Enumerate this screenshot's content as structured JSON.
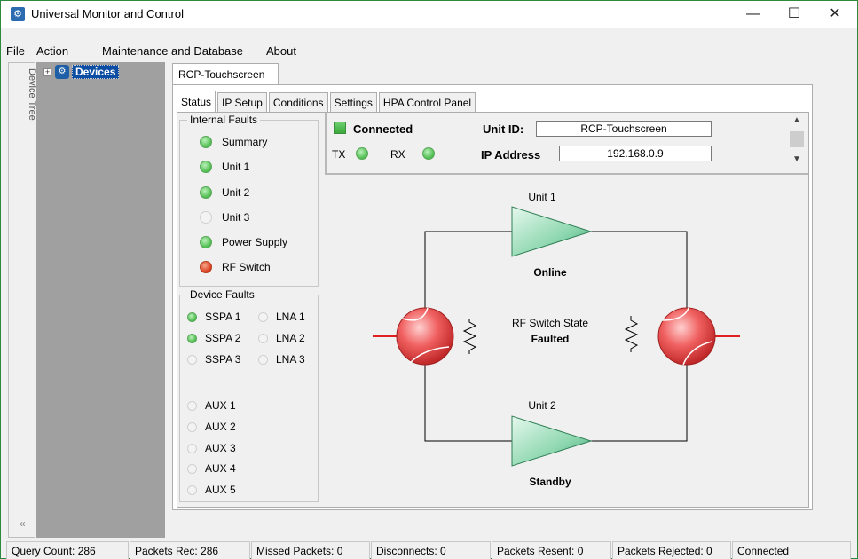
{
  "window": {
    "title": "Universal Monitor and Control",
    "minimize": "—",
    "maximize": "☐",
    "close": "✕"
  },
  "menu": [
    {
      "label": "File"
    },
    {
      "label": "Action"
    },
    {
      "label": "Maintenance and Database"
    },
    {
      "label": "About"
    }
  ],
  "left_strip": {
    "label": "Device Tree",
    "collapse": "«"
  },
  "tree": {
    "expander": "+",
    "root_label": "Devices"
  },
  "main_tab": {
    "label": "RCP-Touchscreen"
  },
  "subtabs": [
    "Status",
    "IP Setup",
    "Conditions",
    "Settings",
    "HPA Control Panel"
  ],
  "internal_faults": {
    "title": "Internal Faults",
    "items": [
      {
        "label": "Summary",
        "state": "green"
      },
      {
        "label": "Unit 1",
        "state": "green"
      },
      {
        "label": "Unit 2",
        "state": "green"
      },
      {
        "label": "Unit 3",
        "state": "off"
      },
      {
        "label": "Power Supply",
        "state": "green"
      },
      {
        "label": "RF Switch",
        "state": "red"
      }
    ]
  },
  "device_faults": {
    "title": "Device Faults",
    "sspa": [
      {
        "label": "SSPA 1",
        "state": "green"
      },
      {
        "label": "SSPA 2",
        "state": "green"
      },
      {
        "label": "SSPA 3",
        "state": "off"
      }
    ],
    "lna": [
      {
        "label": "LNA 1",
        "state": "off"
      },
      {
        "label": "LNA 2",
        "state": "off"
      },
      {
        "label": "LNA 3",
        "state": "off"
      }
    ],
    "aux": [
      {
        "label": "AUX 1",
        "state": "off"
      },
      {
        "label": "AUX 2",
        "state": "off"
      },
      {
        "label": "AUX 3",
        "state": "off"
      },
      {
        "label": "AUX 4",
        "state": "off"
      },
      {
        "label": "AUX 5",
        "state": "off"
      }
    ]
  },
  "connection": {
    "status": "Connected",
    "tx_label": "TX",
    "rx_label": "RX",
    "unit_id_label": "Unit ID:",
    "unit_id_value": "RCP-Touchscreen",
    "ip_label": "IP Address",
    "ip_value": "192.168.0.9"
  },
  "scroll": {
    "up": "▲",
    "down": "▼"
  },
  "diagram": {
    "unit1_label": "Unit 1",
    "unit1_state": "Online",
    "unit2_label": "Unit 2",
    "unit2_state": "Standby",
    "switch_state_label": "RF Switch State",
    "switch_state_value": "Faulted",
    "colors": {
      "switch_fill": "#f06060",
      "amp_fill": "#7fd3a8",
      "line": "#000000",
      "rf_line": "#e02020"
    }
  },
  "status_bar": [
    "Query Count: 286",
    "Packets Rec: 286",
    "Missed Packets: 0",
    "Disconnects: 0",
    "Packets Resent: 0",
    "Packets Rejected: 0",
    "Connected"
  ]
}
